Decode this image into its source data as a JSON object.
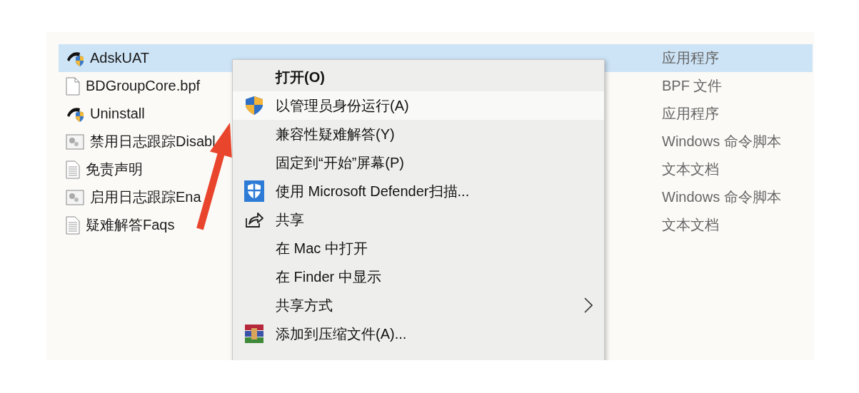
{
  "files": [
    {
      "name": "AdskUAT",
      "type": "应用程序",
      "kind": "app",
      "selected": true
    },
    {
      "name": "BDGroupCore.bpf",
      "type": "BPF 文件",
      "kind": "blank",
      "selected": false
    },
    {
      "name": "Uninstall",
      "type": "应用程序",
      "kind": "app",
      "selected": false
    },
    {
      "name": "禁用日志跟踪Disabl",
      "type": "Windows 命令脚本",
      "kind": "script",
      "selected": false
    },
    {
      "name": "免责声明",
      "type": "文本文档",
      "kind": "text",
      "selected": false
    },
    {
      "name": "启用日志跟踪Ena",
      "type": "Windows 命令脚本",
      "kind": "script",
      "selected": false
    },
    {
      "name": "疑难解答Faqs",
      "type": "文本文档",
      "kind": "text",
      "selected": false
    }
  ],
  "context_menu": {
    "items": [
      {
        "label": "打开(O)",
        "kind": "plain",
        "default": true,
        "hovered": false,
        "submenu": false
      },
      {
        "label": "以管理员身份运行(A)",
        "kind": "uac",
        "default": false,
        "hovered": true,
        "submenu": false
      },
      {
        "label": "兼容性疑难解答(Y)",
        "kind": "plain",
        "default": false,
        "hovered": false,
        "submenu": false
      },
      {
        "label": "固定到“开始”屏幕(P)",
        "kind": "plain",
        "default": false,
        "hovered": false,
        "submenu": false
      },
      {
        "label": "使用 Microsoft Defender扫描...",
        "kind": "defender",
        "default": false,
        "hovered": false,
        "submenu": false
      },
      {
        "label": "共享",
        "kind": "share",
        "default": false,
        "hovered": false,
        "submenu": false
      },
      {
        "label": "在 Mac 中打开",
        "kind": "plain",
        "default": false,
        "hovered": false,
        "submenu": false
      },
      {
        "label": "在 Finder 中显示",
        "kind": "plain",
        "default": false,
        "hovered": false,
        "submenu": false
      },
      {
        "label": "共享方式",
        "kind": "plain",
        "default": false,
        "hovered": false,
        "submenu": true
      },
      {
        "label": "添加到压缩文件(A)...",
        "kind": "rar",
        "default": false,
        "hovered": false,
        "submenu": false
      }
    ]
  },
  "annotation": {
    "kind": "arrow"
  }
}
